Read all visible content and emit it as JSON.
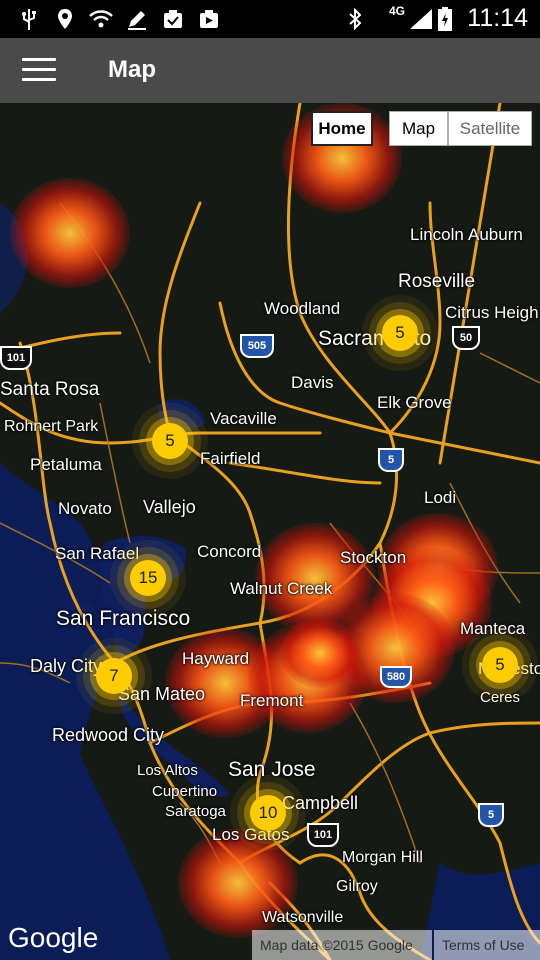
{
  "status_bar": {
    "time": "11:14",
    "network": "4G",
    "icons": [
      "usb-icon",
      "location-icon",
      "wifi-question-icon",
      "pen-icon",
      "clipboard-check-icon",
      "media-icon",
      "bluetooth-icon",
      "signal-icon",
      "battery-charging-icon"
    ]
  },
  "appbar": {
    "title": "Map",
    "menu_icon": "hamburger-menu-icon"
  },
  "map": {
    "home_button": "Home",
    "map_type_map": "Map",
    "map_type_satellite": "Satellite",
    "logo": "Google",
    "attribution": "Map data ©2015 Google",
    "terms": "Terms of Use",
    "cities": [
      {
        "name": "Lincoln"
      },
      {
        "name": "Auburn"
      },
      {
        "name": "Roseville"
      },
      {
        "name": "Woodland"
      },
      {
        "name": "Citrus Heigh"
      },
      {
        "name": "Sacramento"
      },
      {
        "name": "Davis"
      },
      {
        "name": "Santa Rosa"
      },
      {
        "name": "Elk Grove"
      },
      {
        "name": "Vacaville"
      },
      {
        "name": "Rohnert Park"
      },
      {
        "name": "Fairfield"
      },
      {
        "name": "Petaluma"
      },
      {
        "name": "Lodi"
      },
      {
        "name": "Novato"
      },
      {
        "name": "Vallejo"
      },
      {
        "name": "San Rafael"
      },
      {
        "name": "Concord"
      },
      {
        "name": "San Francisco"
      },
      {
        "name": "Manteca"
      },
      {
        "name": "Daly City"
      },
      {
        "name": "Hayward"
      },
      {
        "name": "San Mateo"
      },
      {
        "name": "Ceres"
      },
      {
        "name": "Redwood City"
      },
      {
        "name": "San Jose"
      },
      {
        "name": "Los Altos"
      },
      {
        "name": "Cupertino"
      },
      {
        "name": "Campbell"
      },
      {
        "name": "Saratoga"
      },
      {
        "name": "Los Gatos"
      },
      {
        "name": "Morgan Hill"
      },
      {
        "name": "Gilroy"
      },
      {
        "name": "Watsonville"
      },
      {
        "name": "Walnut Creek"
      },
      {
        "name": "Fremont"
      },
      {
        "name": "Modesto"
      },
      {
        "name": "Stockton"
      }
    ],
    "highway_shields": [
      "505",
      "101",
      "50",
      "5",
      "5",
      "101",
      "580",
      "5"
    ],
    "clusters": [
      {
        "count": "5"
      },
      {
        "count": "5"
      },
      {
        "count": "15"
      },
      {
        "count": "7"
      },
      {
        "count": "10"
      },
      {
        "count": "5"
      }
    ],
    "heat_marker_count": 10
  }
}
